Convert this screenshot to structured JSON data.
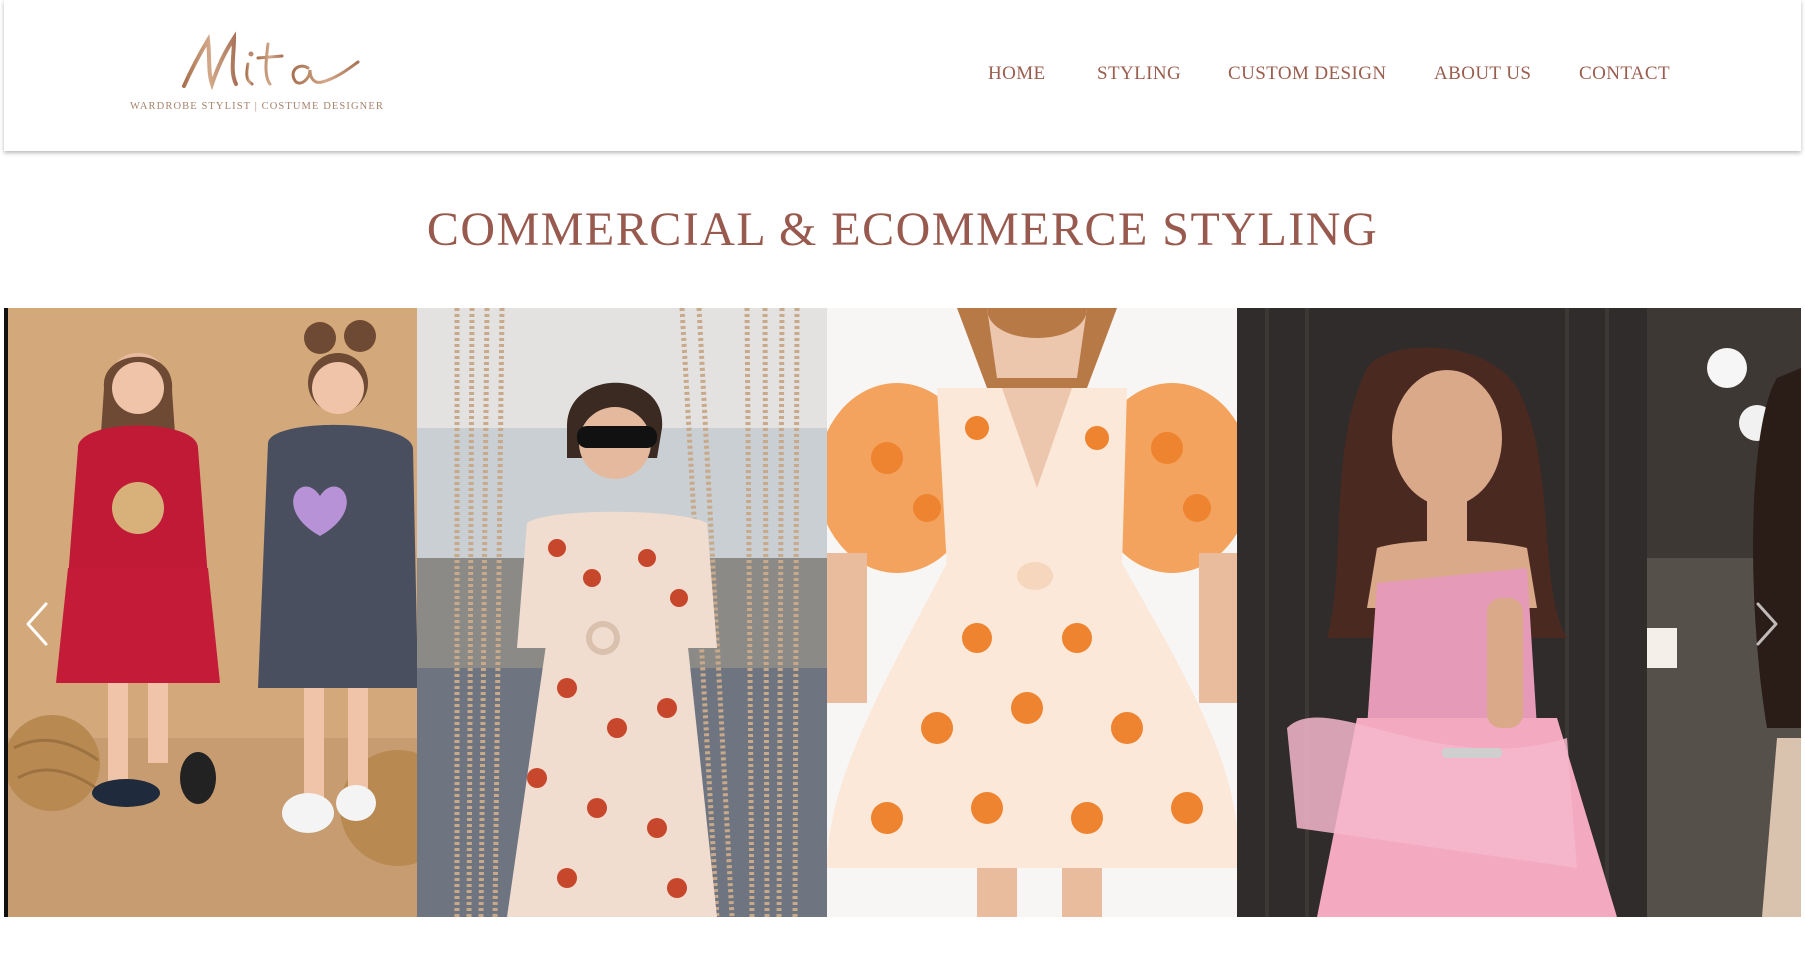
{
  "brand": {
    "logo_script": "Mita",
    "tagline": "WARDROBE STYLIST | COSTUME DESIGNER"
  },
  "nav": {
    "items": [
      {
        "label": "HOME"
      },
      {
        "label": "STYLING"
      },
      {
        "label": "CUSTOM DESIGN"
      },
      {
        "label": "ABOUT US"
      },
      {
        "label": "CONTACT"
      }
    ]
  },
  "page": {
    "title": "COMMERCIAL & ECOMMERCE STYLING"
  },
  "gallery": {
    "slides": [
      {
        "subject": "two girls in hoodie dresses"
      },
      {
        "subject": "woman in shell print dress by beaded curtain"
      },
      {
        "subject": "orange floral puff sleeve mini dress"
      },
      {
        "subject": "woman in pink embellished gown"
      },
      {
        "subject": "partial portrait"
      }
    ],
    "prev_icon": "chevron-left-icon",
    "next_icon": "chevron-right-icon"
  },
  "colors": {
    "accent": "#985a4e",
    "nav_text": "#9a5d4e",
    "logo_gold": "#b98a6e"
  }
}
